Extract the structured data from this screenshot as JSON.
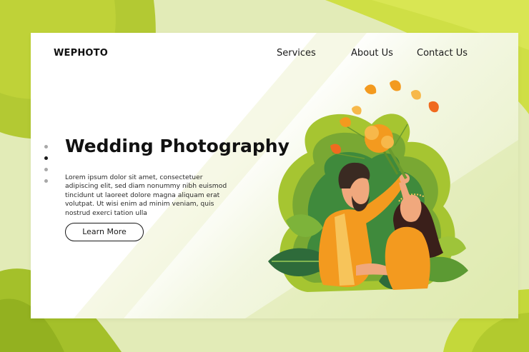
{
  "brand": {
    "name": "WEPHOTO"
  },
  "nav": {
    "items": [
      {
        "label": "Services"
      },
      {
        "label": "About Us"
      },
      {
        "label": "Contact Us"
      }
    ]
  },
  "hero": {
    "title": "Wedding Photography",
    "body": "Lorem ipsum dolor sit amet, consectetuer adipiscing elit, sed diam nonummy nibh euismod tincidunt ut laoreet dolore magna aliquam erat volutpat. Ut wisi enim ad minim veniam, quis nostrud exerci tation ulla",
    "cta_label": "Learn More",
    "slide_dots": {
      "count": 4,
      "active_index": 1
    }
  },
  "illustration": {
    "subject": "couple-with-flower-bouquet",
    "colors": {
      "accent_green": "#b9cf3a",
      "leaf_dark": "#2e6b3a",
      "orange": "#f39a1f",
      "skin": "#f0a87d"
    }
  }
}
